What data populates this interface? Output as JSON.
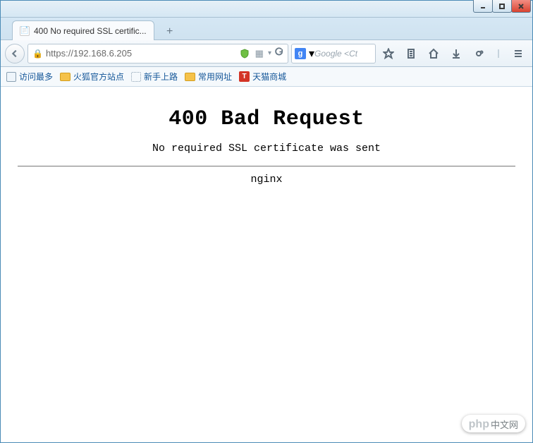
{
  "window": {
    "tab_title": "400 No required SSL certific...",
    "new_tab_tooltip": "+"
  },
  "address_bar": {
    "url": "https://192.168.6.205",
    "search_placeholder": "Google <Ct",
    "search_engine_letter": "g"
  },
  "bookmarks": [
    {
      "icon": "page",
      "label": "访问最多"
    },
    {
      "icon": "folder",
      "label": "火狐官方站点"
    },
    {
      "icon": "doc",
      "label": "新手上路"
    },
    {
      "icon": "folder",
      "label": "常用网址"
    },
    {
      "icon": "t",
      "label": "天猫商城"
    }
  ],
  "page": {
    "heading": "400 Bad Request",
    "subtitle": "No required SSL certificate was sent",
    "server": "nginx"
  },
  "watermark": {
    "brand": "php",
    "text": "中文网"
  }
}
